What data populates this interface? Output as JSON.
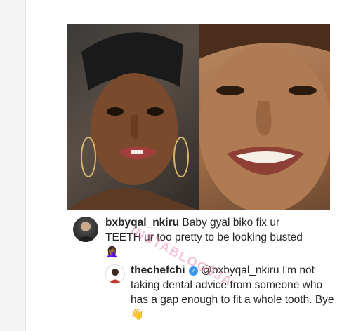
{
  "comments": [
    {
      "username": "bxbyqal_nkiru",
      "text": "Baby gyal biko fix ur TEETH ur too pretty to be looking busted",
      "emoji": "🤦🏾‍♀️"
    },
    {
      "username": "thechefchi",
      "mention": "@bxbyqal_nkiru",
      "text": "I'm not taking dental advice from someone who has a gap enough to fit a whole tooth. Bye",
      "emoji": "👋"
    }
  ],
  "watermark": "INSTABLOG9JA"
}
